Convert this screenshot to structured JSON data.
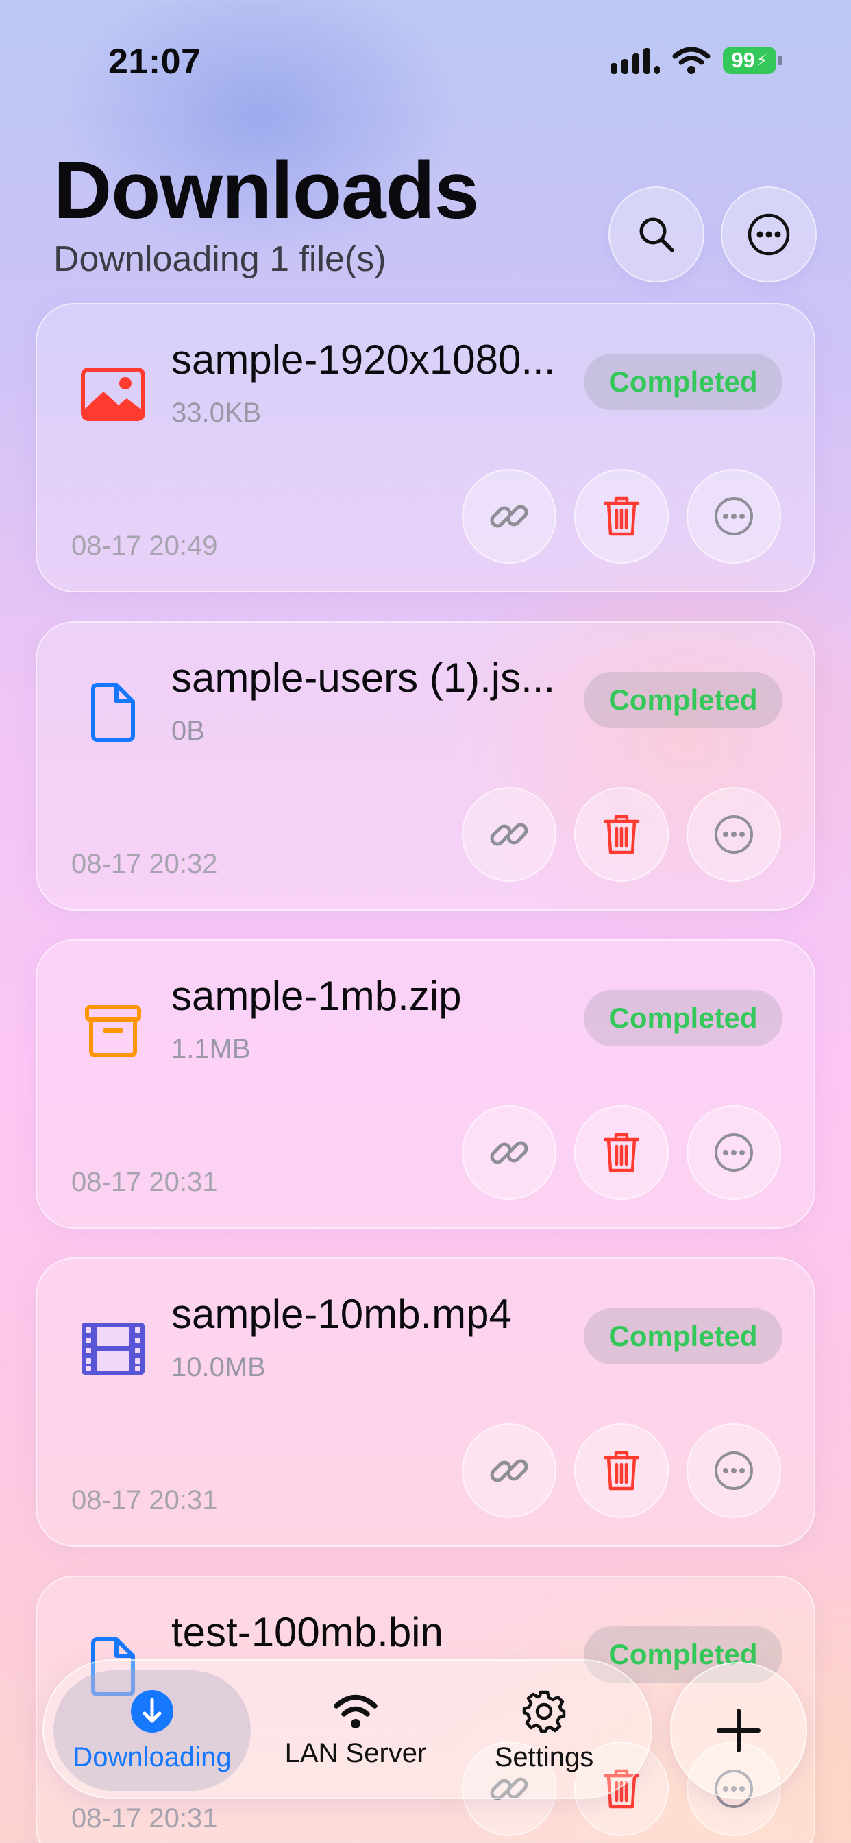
{
  "status_bar": {
    "time": "21:07",
    "battery": "99"
  },
  "header": {
    "title": "Downloads",
    "subtitle": "Downloading 1 file(s)"
  },
  "files": [
    {
      "name": "sample-1920x1080...",
      "size": "33.0KB",
      "status": "Completed",
      "date": "08-17 20:49",
      "icon": "image-icon",
      "icon_color": "#ff3b30"
    },
    {
      "name": "sample-users (1).js...",
      "size": "0B",
      "status": "Completed",
      "date": "08-17 20:32",
      "icon": "document-icon",
      "icon_color": "#1677ff"
    },
    {
      "name": "sample-1mb.zip",
      "size": "1.1MB",
      "status": "Completed",
      "date": "08-17 20:31",
      "icon": "archive-icon",
      "icon_color": "#ff9500"
    },
    {
      "name": "sample-10mb.mp4",
      "size": "10.0MB",
      "status": "Completed",
      "date": "08-17 20:31",
      "icon": "film-icon",
      "icon_color": "#5856d6"
    },
    {
      "name": "test-100mb.bin",
      "size": "",
      "status": "Completed",
      "date": "08-17 20:31",
      "icon": "document-icon",
      "icon_color": "#1677ff"
    }
  ],
  "tab_bar": {
    "tabs": [
      {
        "label": "Downloading",
        "icon": "download-icon",
        "active": true
      },
      {
        "label": "LAN Server",
        "icon": "wifi-icon",
        "active": false
      },
      {
        "label": "Settings",
        "icon": "gear-icon",
        "active": false
      }
    ]
  },
  "colors": {
    "accent": "#1677ff",
    "completed": "#34c759",
    "delete": "#ff3b30"
  }
}
